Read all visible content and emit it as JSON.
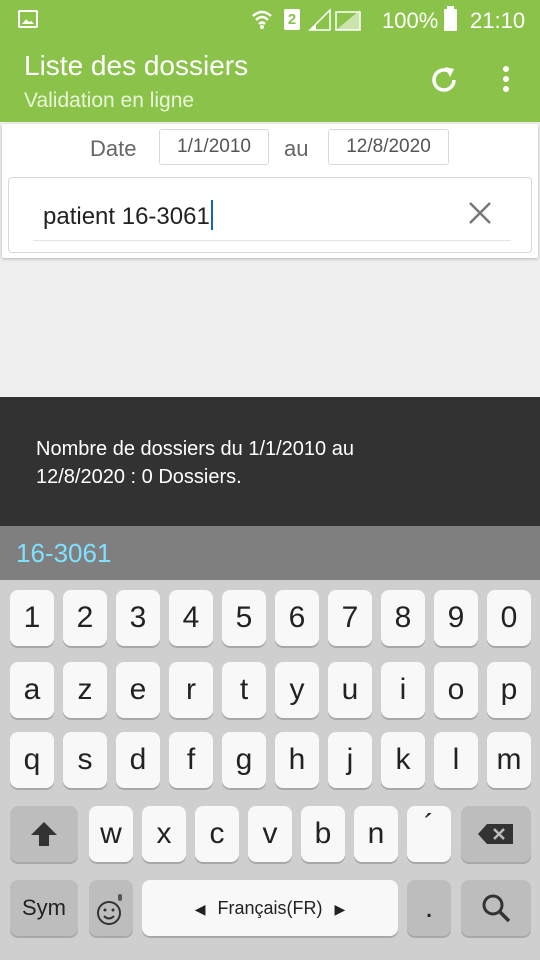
{
  "status_bar": {
    "sim_slot": "2",
    "battery": "100%",
    "time": "21:10",
    "icons": [
      "gallery-icon",
      "wifi-icon",
      "sim-icon",
      "signal-icon",
      "battery-icon"
    ]
  },
  "app_bar": {
    "title": "Liste des dossiers",
    "subtitle": "Validation en ligne",
    "color": "#8bc34a",
    "actions": [
      "refresh-icon",
      "more-icon"
    ]
  },
  "filter": {
    "date_label": "Date",
    "date_from": "1/1/2010",
    "separator": "au",
    "date_to": "12/8/2020",
    "search_value": "patient 16-3061"
  },
  "toast": {
    "message": "Nombre de dossiers du 1/1/2010 au 12/8/2020 : 0 Dossiers."
  },
  "keyboard": {
    "suggestion": "16-3061",
    "row_numbers": [
      "1",
      "2",
      "3",
      "4",
      "5",
      "6",
      "7",
      "8",
      "9",
      "0"
    ],
    "row_1": [
      "a",
      "z",
      "e",
      "r",
      "t",
      "y",
      "u",
      "i",
      "o",
      "p"
    ],
    "row_2": [
      "q",
      "s",
      "d",
      "f",
      "g",
      "h",
      "j",
      "k",
      "l",
      "m"
    ],
    "row_3": [
      "w",
      "x",
      "c",
      "v",
      "b",
      "n",
      "´"
    ],
    "sym_label": "Sym",
    "language_label": "Français(FR)",
    "period_label": "."
  }
}
